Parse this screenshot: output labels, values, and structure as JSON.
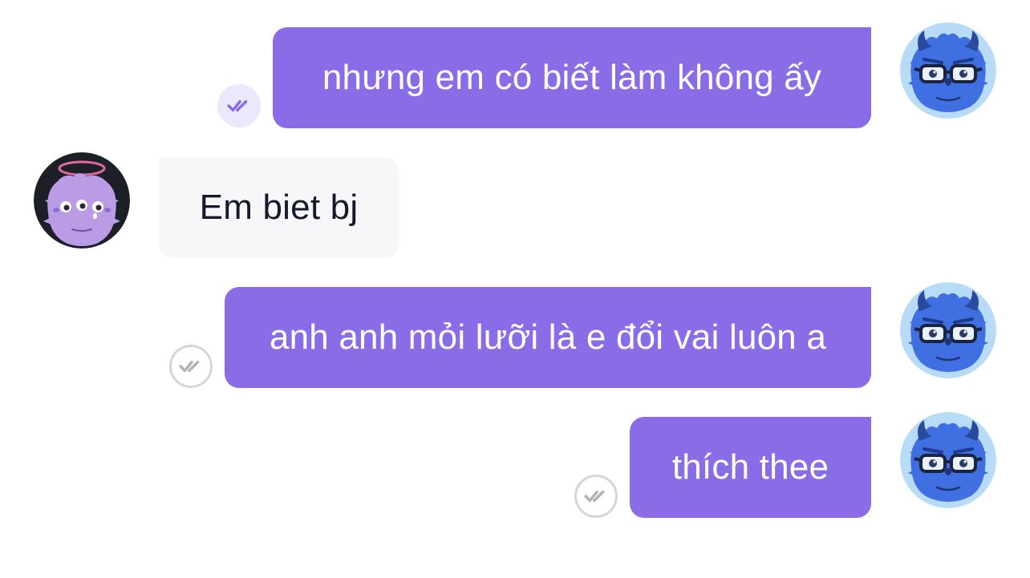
{
  "colors": {
    "outgoing_bubble": "#8a6de6",
    "incoming_bubble": "#f7f7fa",
    "read_check": "#8a6de6",
    "unread_check": "#aeb2bb"
  },
  "messages": [
    {
      "direction": "outgoing",
      "text": "nhưng em có biết làm không ấy",
      "status": "read",
      "avatar": "blue-monster-with-glasses-avatar"
    },
    {
      "direction": "incoming",
      "text": "Em biet bj",
      "avatar": "purple-three-eyed-monster-with-halo-avatar"
    },
    {
      "direction": "outgoing",
      "text": "anh anh mỏi lưỡi là e đổi vai luôn a",
      "status": "delivered",
      "avatar": "blue-monster-with-glasses-avatar"
    },
    {
      "direction": "outgoing",
      "text": "thích thee",
      "status": "delivered",
      "avatar": "blue-monster-with-glasses-avatar"
    }
  ]
}
